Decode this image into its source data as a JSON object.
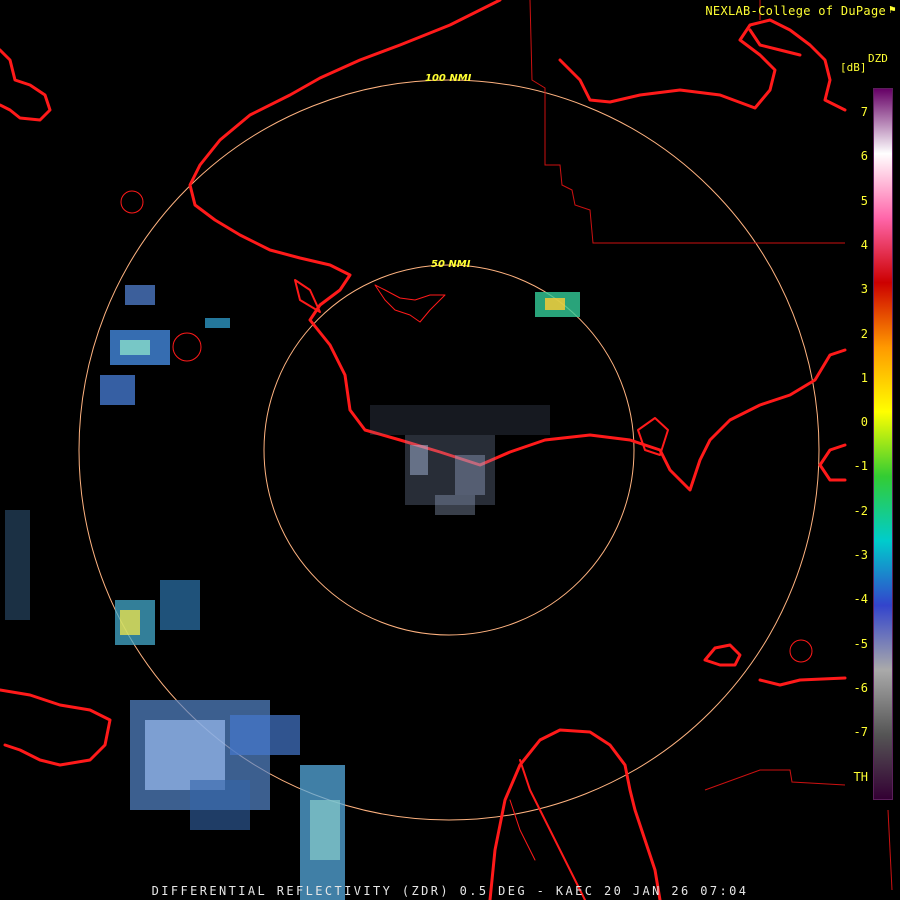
{
  "header": {
    "credit": "NEXLAB-College of DuPage"
  },
  "footer": {
    "caption": "DIFFERENTIAL REFLECTIVITY (ZDR) 0.5 DEG - KAEC 20 JAN 26 07:04"
  },
  "legend": {
    "product": "DZD",
    "unit": "[dB]",
    "ticks": [
      "7",
      "6",
      "5",
      "4",
      "3",
      "2",
      "1",
      "0",
      "-1",
      "-2",
      "-3",
      "-4",
      "-5",
      "-6",
      "-7",
      "TH"
    ],
    "colors": [
      "#660066",
      "#ffffff",
      "#ff66aa",
      "#cc0000",
      "#ff9900",
      "#ffff00",
      "#33cc33",
      "#00cccc",
      "#3344cc",
      "#aaaaaa",
      "#555555",
      "#330033"
    ]
  },
  "map": {
    "range_rings": [
      {
        "label": "50 NMI"
      },
      {
        "label": "100 NMI"
      }
    ],
    "coastline_color": "#ff1a1a",
    "ring_color": "#ffb380"
  }
}
